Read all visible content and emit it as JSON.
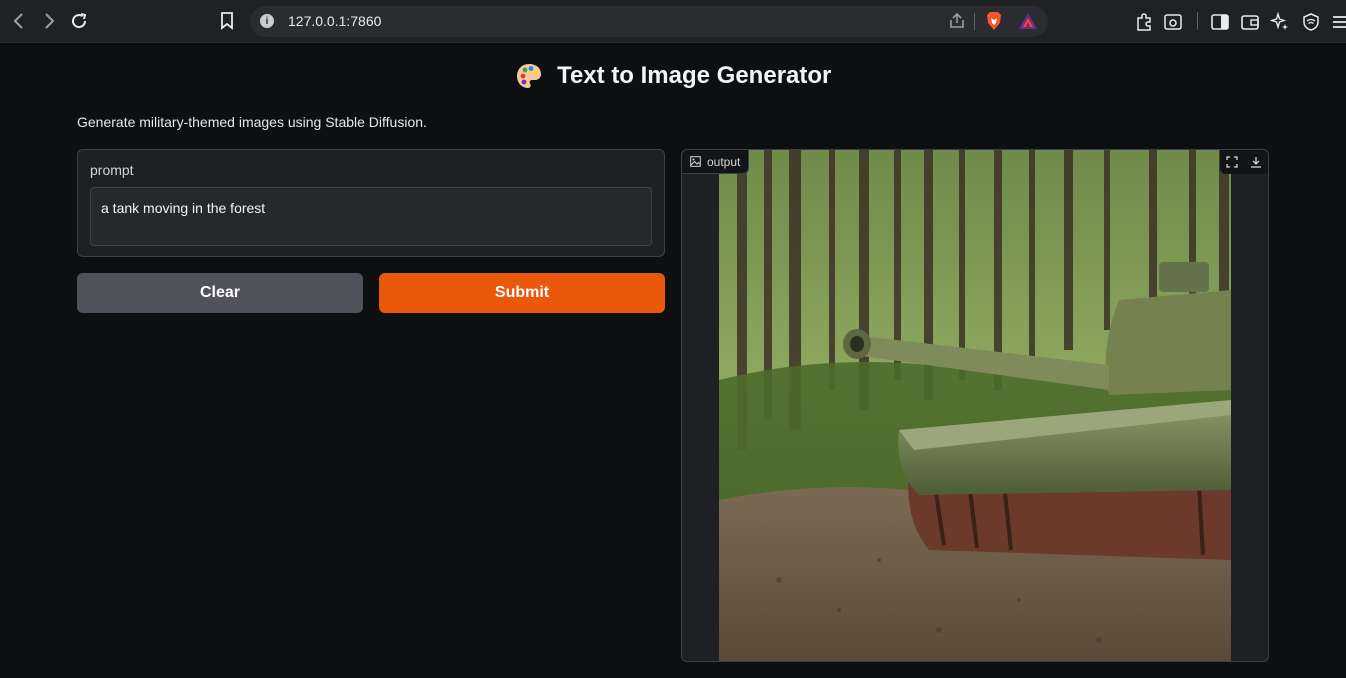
{
  "browser": {
    "url": "127.0.0.1:7860"
  },
  "app": {
    "title_emoji_icon": "artist-palette-icon",
    "title": "Text to Image Generator",
    "description": "Generate military-themed images using Stable Diffusion."
  },
  "input": {
    "label": "prompt",
    "value": "a tank moving in the forest"
  },
  "buttons": {
    "clear_label": "Clear",
    "submit_label": "Submit"
  },
  "output": {
    "label": "output",
    "image_icon": "image-icon",
    "fullscreen_icon": "fullscreen-icon",
    "download_icon": "download-icon"
  },
  "colors": {
    "submit": "#ea580c",
    "clear": "#52535a",
    "background": "#0e0f11"
  }
}
